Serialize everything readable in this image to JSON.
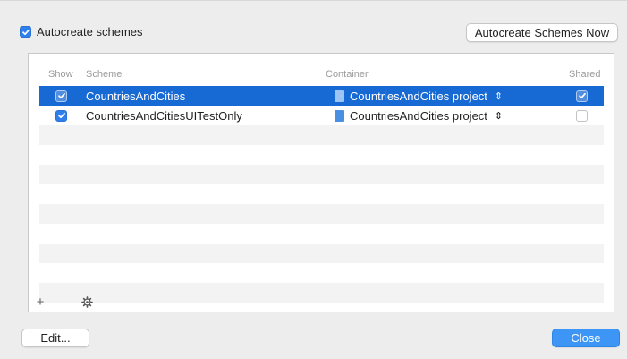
{
  "autocreate": {
    "checked": true,
    "label": "Autocreate schemes",
    "button_label": "Autocreate Schemes Now"
  },
  "table": {
    "headers": {
      "show": "Show",
      "scheme": "Scheme",
      "container": "Container",
      "shared": "Shared"
    },
    "rows": [
      {
        "show": true,
        "scheme": "CountriesAndCities",
        "container": "CountriesAndCities project",
        "stepper": "⇕",
        "shared": true,
        "selected": true
      },
      {
        "show": true,
        "scheme": "CountriesAndCitiesUITestOnly",
        "container": "CountriesAndCities project",
        "stepper": "⇕",
        "shared": false,
        "selected": false
      }
    ]
  },
  "toolbar": {
    "add_glyph": "+",
    "remove_glyph": "—",
    "settings_icon": "gear-icon"
  },
  "buttons": {
    "edit_label": "Edit...",
    "close_label": "Close"
  },
  "colors": {
    "selection": "#1769d4",
    "close_button": "#3d96f6",
    "checkbox_blue": "#2f80ed"
  }
}
